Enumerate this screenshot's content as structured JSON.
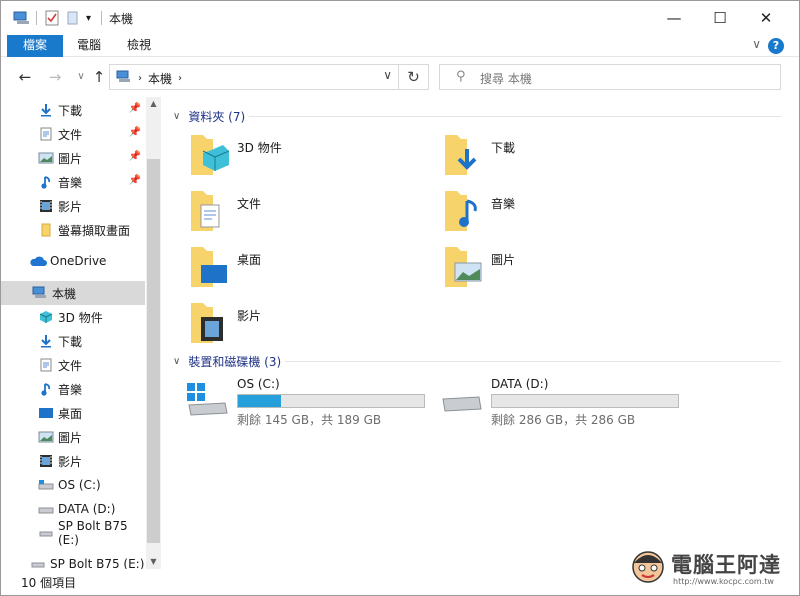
{
  "window": {
    "title": "本機",
    "minimize": "—",
    "maximize": "☐",
    "close": "✕"
  },
  "ribbon": {
    "tabs": [
      "檔案",
      "電腦",
      "檢視"
    ],
    "help": "?"
  },
  "address": {
    "location": "本機",
    "search_placeholder": "搜尋 本機"
  },
  "nav": {
    "quick_access": [
      {
        "label": "下載",
        "icon": "download-icon",
        "pinned": true
      },
      {
        "label": "文件",
        "icon": "document-icon",
        "pinned": true
      },
      {
        "label": "圖片",
        "icon": "picture-icon",
        "pinned": true
      },
      {
        "label": "音樂",
        "icon": "music-icon",
        "pinned": true
      },
      {
        "label": "影片",
        "icon": "video-icon",
        "pinned": false
      },
      {
        "label": "螢幕擷取畫面",
        "icon": "folder-icon",
        "pinned": false
      }
    ],
    "onedrive": "OneDrive",
    "this_pc": "本機",
    "this_pc_items": [
      {
        "label": "3D 物件",
        "icon": "3d-objects-icon"
      },
      {
        "label": "下載",
        "icon": "download-icon"
      },
      {
        "label": "文件",
        "icon": "document-icon"
      },
      {
        "label": "音樂",
        "icon": "music-icon"
      },
      {
        "label": "桌面",
        "icon": "desktop-icon"
      },
      {
        "label": "圖片",
        "icon": "picture-icon"
      },
      {
        "label": "影片",
        "icon": "video-icon"
      },
      {
        "label": "OS (C:)",
        "icon": "drive-icon"
      },
      {
        "label": "DATA (D:)",
        "icon": "drive-icon"
      },
      {
        "label": "SP Bolt B75 (E:)",
        "icon": "usb-drive-icon"
      }
    ],
    "extra_item": {
      "label": "SP Bolt B75 (E:)",
      "icon": "usb-drive-icon"
    }
  },
  "content": {
    "folders_header": "資料夾 (7)",
    "folders": [
      {
        "label": "3D 物件",
        "icon": "3d-objects-folder-icon"
      },
      {
        "label": "下載",
        "icon": "downloads-folder-icon"
      },
      {
        "label": "文件",
        "icon": "documents-folder-icon"
      },
      {
        "label": "音樂",
        "icon": "music-folder-icon"
      },
      {
        "label": "桌面",
        "icon": "desktop-folder-icon"
      },
      {
        "label": "圖片",
        "icon": "pictures-folder-icon"
      },
      {
        "label": "影片",
        "icon": "videos-folder-icon"
      }
    ],
    "devices_header": "裝置和磁碟機 (3)",
    "drives": [
      {
        "name": "OS (C:)",
        "free": "剩餘 145 GB，共 189 GB",
        "used_fraction": 0.23,
        "icon": "windows-drive-icon"
      },
      {
        "name": "DATA (D:)",
        "free": "剩餘 286 GB，共 286 GB",
        "used_fraction": 0.0,
        "icon": "drive-icon"
      }
    ]
  },
  "status": {
    "count": "10 個項目"
  },
  "watermark": {
    "text": "電腦王阿達",
    "url": "http://www.kocpc.com.tw"
  },
  "colors": {
    "accent": "#1979ca",
    "folder": "#f6d36b",
    "bar_fill": "#26a0da",
    "group_header": "#1e3287"
  }
}
